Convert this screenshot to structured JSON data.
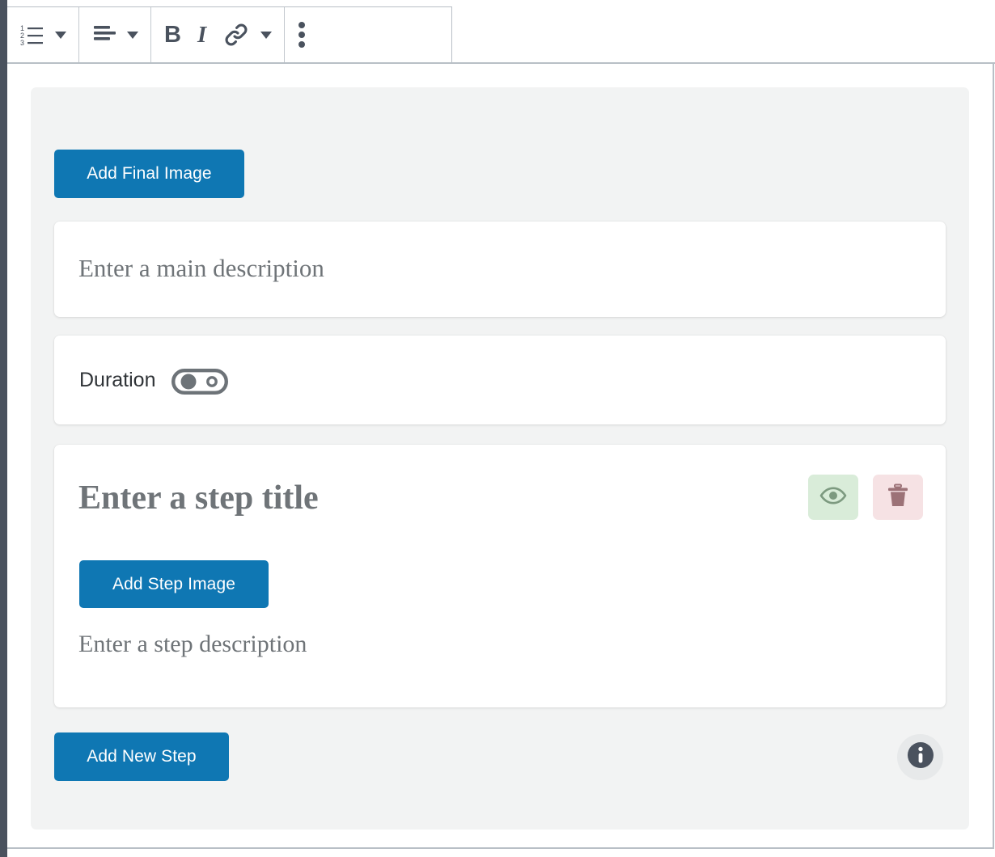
{
  "toolbar": {
    "groups": [
      {
        "name": "list-group",
        "items": [
          {
            "icon": "numbered-list-icon",
            "label": "Numbered list"
          },
          {
            "icon": "chevron-down-icon",
            "label": "List options"
          }
        ]
      },
      {
        "name": "align-group",
        "items": [
          {
            "icon": "align-left-icon",
            "label": "Align"
          },
          {
            "icon": "chevron-down-icon",
            "label": "Alignment options"
          }
        ]
      },
      {
        "name": "format-group",
        "items": [
          {
            "icon": "bold-icon",
            "label": "B"
          },
          {
            "icon": "italic-icon",
            "label": "I"
          },
          {
            "icon": "link-icon",
            "label": "Insert link"
          },
          {
            "icon": "chevron-down-icon",
            "label": "More formatting"
          }
        ]
      },
      {
        "name": "overflow-group",
        "items": [
          {
            "icon": "kebab-menu-icon",
            "label": "More options"
          }
        ]
      }
    ]
  },
  "editor": {
    "add_final_image_label": "Add Final Image",
    "main_description_placeholder": "Enter a main description",
    "duration": {
      "label": "Duration",
      "toggle_state": "off",
      "toggle_icon": "toggle-off-icon"
    },
    "step": {
      "title_placeholder": "Enter a step title",
      "add_step_image_label": "Add Step Image",
      "description_placeholder": "Enter a step description",
      "preview_icon": "eye-icon",
      "delete_icon": "trash-icon"
    },
    "add_new_step_label": "Add New Step",
    "info_icon": "info-icon"
  },
  "colors": {
    "primary_blue": "#0f77b3",
    "panel_gray": "#f2f3f3",
    "rail_dark": "#4a525e",
    "preview_green": "#d9ecd9",
    "delete_pink": "#f6e2e4",
    "eye_icon": "#7d9a80",
    "trash_icon": "#9c7277",
    "placeholder_text": "#6f7478"
  }
}
